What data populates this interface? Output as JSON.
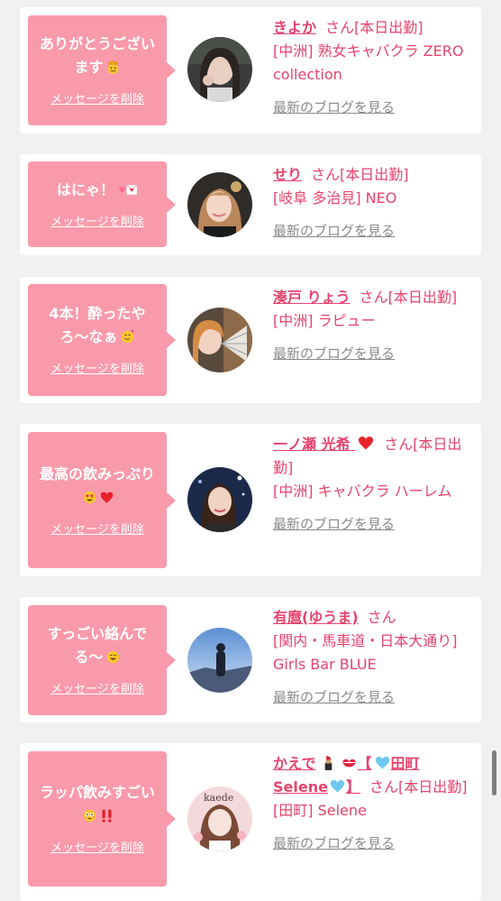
{
  "delete_label": "メッセージを削除",
  "blog_label": "最新のブログを見る",
  "san": "さん",
  "cards": [
    {
      "message": "ありがとうございます",
      "name": "きよか",
      "status": "[本日出勤]",
      "shop": "[中洲] 熟女キャバクラ ZERO collection"
    },
    {
      "message": "はにゃ！",
      "name": "せり",
      "status": "[本日出勤]",
      "shop": "[岐阜 多治見] NEO"
    },
    {
      "message": "4本！酔ったやろ〜なぁ",
      "name": "湊戸 りょう",
      "status": "[本日出勤]",
      "shop": "[中洲] ラピュー"
    },
    {
      "message": "最高の飲みっぷり",
      "name": "一ノ瀬 光希",
      "status": "[本日出勤]",
      "shop": "[中洲] キャバクラ ハーレム"
    },
    {
      "message": "すっごい絡んでる〜",
      "name": "有麿(ゆうま)",
      "status": "",
      "shop": "[関内・馬車道・日本大通り] Girls Bar BLUE"
    },
    {
      "message": "ラッパ飲みすごい",
      "name": "かえで",
      "name_part2": "【",
      "name_part3": "田町 Selene",
      "name_part4": "】",
      "status": "[本日出勤]",
      "shop": "[田町] Selene"
    }
  ],
  "colors": {
    "bubble": "#f99aab",
    "accent": "#e6436d",
    "link_gray": "#8a8a8a",
    "background": "#f1f1f1"
  },
  "icons": [
    "crown-face-icon",
    "heart-letter-icon",
    "smiling-hearts-icon",
    "heart-eyes-icon",
    "red-heart-icon",
    "sweat-smile-icon",
    "flushed-face-icon",
    "double-exclamation-icon",
    "lipstick-icon",
    "kiss-mark-icon",
    "light-blue-heart-icon"
  ]
}
